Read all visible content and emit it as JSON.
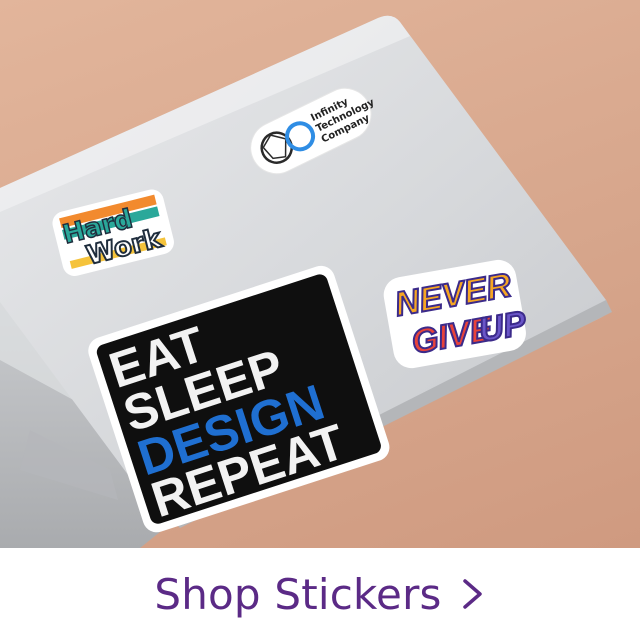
{
  "scene": {
    "background_color": "#d9a98f",
    "laptop_color": "#d3d5d8"
  },
  "stickers": {
    "infinity": {
      "line1": "Infinity",
      "line2": "Technology",
      "line3": "Company"
    },
    "hard_work": {
      "word1": "Hard",
      "word2": "Work"
    },
    "never_give_up": {
      "line1": "NEVER",
      "line2a": "GIVE",
      "line2b": "UP"
    },
    "eat_sleep": {
      "line1": "EAT",
      "line2": "SLEEP",
      "line3": "DESIGN",
      "line4": "REPEAT"
    }
  },
  "cta": {
    "label": "Shop Stickers",
    "color": "#5b2a86",
    "icon": "chevron-right-icon"
  }
}
